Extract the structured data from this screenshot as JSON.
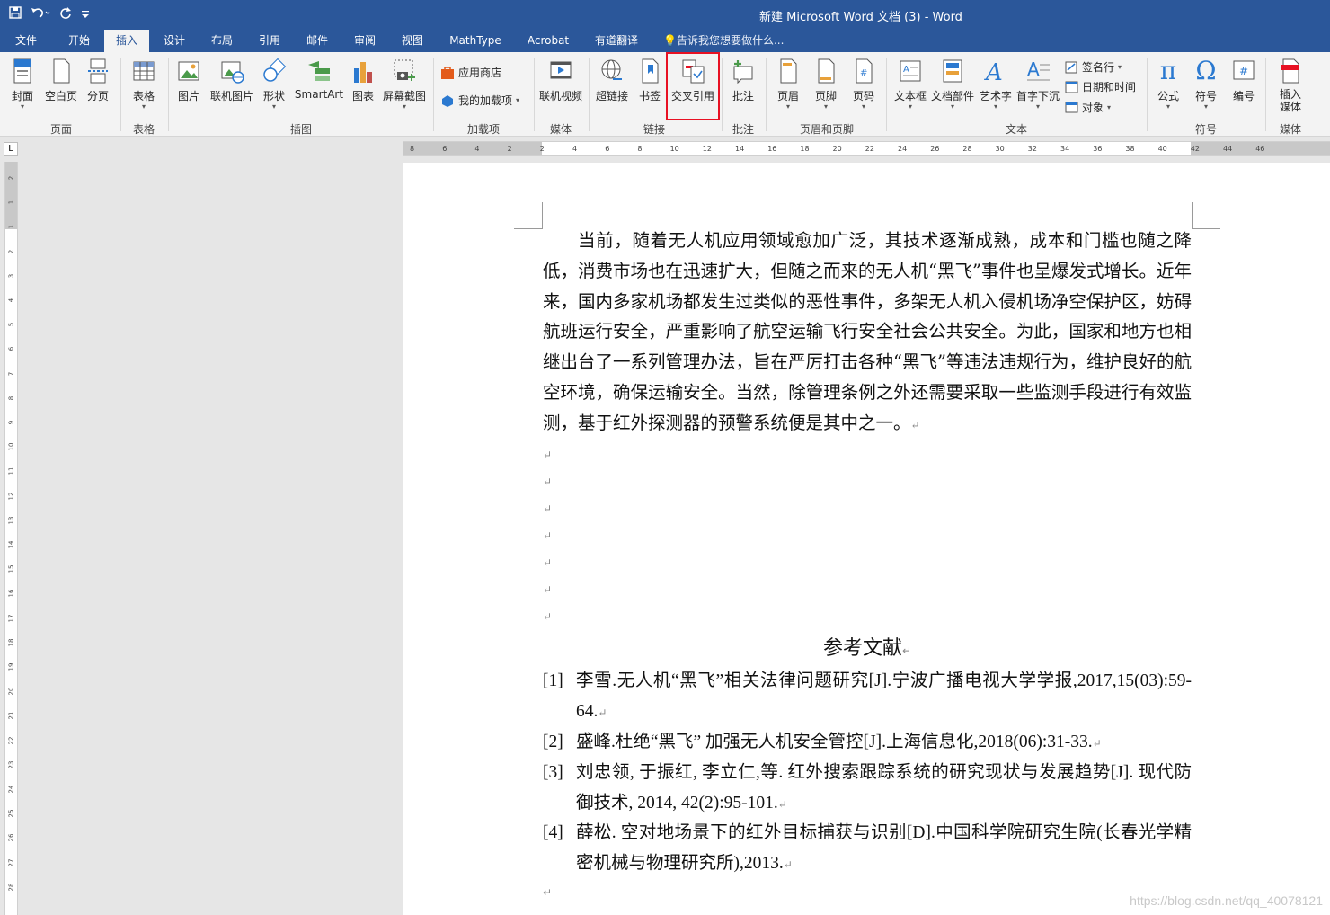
{
  "window": {
    "title": "新建 Microsoft Word 文档 (3) - Word"
  },
  "qat": {
    "save_icon": "save-icon",
    "undo_icon": "undo-icon",
    "redo_icon": "redo-icon",
    "customize_icon": "customize-icon"
  },
  "tabs": [
    "文件",
    "开始",
    "插入",
    "设计",
    "布局",
    "引用",
    "邮件",
    "审阅",
    "视图",
    "MathType",
    "Acrobat",
    "有道翻译"
  ],
  "active_tab": "插入",
  "tell_me": "告诉我您想要做什么...",
  "ribbon": {
    "cover": "封面",
    "blank_page": "空白页",
    "page_break": "分页",
    "table": "表格",
    "picture": "图片",
    "online_picture": "联机图片",
    "shapes": "形状",
    "smartart": "SmartArt",
    "chart": "图表",
    "screenshot": "屏幕截图",
    "store": "应用商店",
    "my_addins": "我的加载项",
    "online_video": "联机视频",
    "hyperlink": "超链接",
    "bookmark": "书签",
    "cross_reference": "交叉引用",
    "comment": "批注",
    "header": "页眉",
    "footer": "页脚",
    "page_number": "页码",
    "textbox": "文本框",
    "quick_parts": "文档部件",
    "wordart": "艺术字",
    "drop_cap": "首字下沉",
    "signature_line": "签名行",
    "date_time": "日期和时间",
    "object": "对象",
    "equation": "公式",
    "symbol": "符号",
    "number": "编号",
    "insert_media": "插入\n媒体",
    "groups": {
      "pages": "页面",
      "tables": "表格",
      "illustrations": "插图",
      "addins": "加载项",
      "media": "媒体",
      "links": "链接",
      "comments": "批注",
      "header_footer": "页眉和页脚",
      "text": "文本",
      "symbols": "符号",
      "media2": "媒体"
    }
  },
  "ruler": {
    "horizontal_ticks": [
      "8",
      "6",
      "4",
      "2",
      "2",
      "4",
      "6",
      "8",
      "10",
      "12",
      "14",
      "16",
      "18",
      "20",
      "22",
      "24",
      "26",
      "28",
      "30",
      "32",
      "34",
      "36",
      "38",
      "40",
      "42",
      "44",
      "46"
    ],
    "vertical_ticks": [
      "2",
      "1",
      "1",
      "2",
      "3",
      "4",
      "5",
      "6",
      "7",
      "8",
      "9",
      "10",
      "11",
      "12",
      "13",
      "14",
      "15",
      "16",
      "17",
      "18",
      "19",
      "20",
      "21",
      "22",
      "23",
      "24",
      "25",
      "26",
      "27",
      "28"
    ]
  },
  "document": {
    "paragraph": "当前，随着无人机应用领域愈加广泛，其技术逐渐成熟，成本和门槛也随之降低，消费市场也在迅速扩大，但随之而来的无人机“黑飞”事件也呈爆发式增长。近年来，国内多家机场都发生过类似的恶性事件，多架无人机入侵机场净空保护区，妨碍航班运行安全，严重影响了航空运输飞行安全社会公共安全。为此，国家和地方也相继出台了一系列管理办法，旨在严厉打击各种“黑飞”等违法违规行为，维护良好的航空环境，确保运输安全。当然，除管理条例之外还需要采取一些监测手段进行有效监测，基于红外探测器的预警系统便是其中之一。",
    "para_mark": "↵",
    "references_title": "参考文献",
    "references": [
      {
        "num": "[1]",
        "text": "李雪.无人机“黑飞”相关法律问题研究[J].宁波广播电视大学学报,2017,15(03):59-64."
      },
      {
        "num": "[2]",
        "text": "盛峰.杜绝“黑飞”  加强无人机安全管控[J].上海信息化,2018(06):31-33."
      },
      {
        "num": "[3]",
        "text": "刘忠领, 于振红, 李立仁,等. 红外搜索跟踪系统的研究现状与发展趋势[J]. 现代防御技术, 2014, 42(2):95-101."
      },
      {
        "num": "[4]",
        "text": "薛松. 空对地场景下的红外目标捕获与识别[D].中国科学院研究生院(长春光学精密机械与物理研究所),2013."
      }
    ]
  },
  "watermark": "https://blog.csdn.net/qq_40078121",
  "colors": {
    "titlebar": "#2b579a",
    "highlight": "#e81123",
    "ribbon": "#f3f3f3"
  }
}
